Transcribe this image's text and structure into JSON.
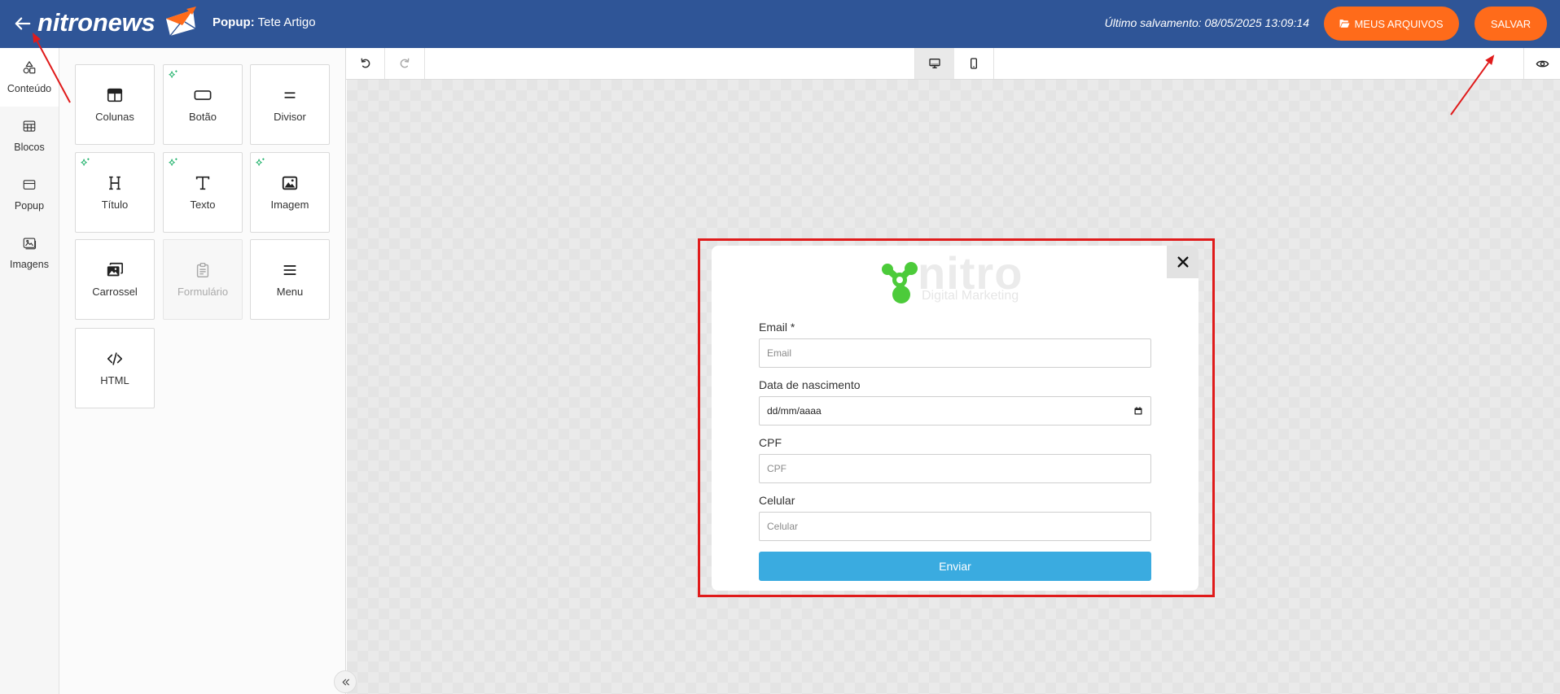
{
  "colors": {
    "header_bar": "#2f5597",
    "accent_orange": "#ff6b1a",
    "submit_button": "#3aabe0",
    "ai_sparkle": "#2bb673",
    "logo_green": "#4ccb3a",
    "annotation_red": "#e01b1b"
  },
  "header": {
    "brand": "nitronews",
    "brand_icon": "envelope-logo-icon",
    "back_icon": "arrow-left-icon",
    "title_prefix": "Popup:",
    "title": "Tete Artigo",
    "last_saved": "Último salvamento: 08/05/2025 13:09:14",
    "my_files": {
      "label": "MEUS ARQUIVOS",
      "icon": "folder-open-icon"
    },
    "save": {
      "label": "SALVAR"
    }
  },
  "sidebar": {
    "items": [
      {
        "label": "Conteúdo",
        "icon": "shapes-icon",
        "active": true
      },
      {
        "label": "Blocos",
        "icon": "blocks-grid-icon",
        "active": false
      },
      {
        "label": "Popup",
        "icon": "popup-window-icon",
        "active": false
      },
      {
        "label": "Imagens",
        "icon": "images-icon",
        "active": false
      }
    ]
  },
  "content_panel": {
    "blocks": [
      {
        "label": "Colunas",
        "icon": "columns-icon",
        "ai": false,
        "disabled": false
      },
      {
        "label": "Botão",
        "icon": "button-icon",
        "ai": true,
        "disabled": false
      },
      {
        "label": "Divisor",
        "icon": "divider-icon",
        "ai": false,
        "disabled": false
      },
      {
        "label": "Título",
        "icon": "heading-icon",
        "ai": true,
        "disabled": false
      },
      {
        "label": "Texto",
        "icon": "text-icon",
        "ai": true,
        "disabled": false
      },
      {
        "label": "Imagem",
        "icon": "image-icon",
        "ai": true,
        "disabled": false
      },
      {
        "label": "Carrossel",
        "icon": "carousel-icon",
        "ai": false,
        "disabled": false
      },
      {
        "label": "Formulário",
        "icon": "form-clipboard-icon",
        "ai": false,
        "disabled": true
      },
      {
        "label": "Menu",
        "icon": "menu-icon",
        "ai": false,
        "disabled": false
      },
      {
        "label": "HTML",
        "icon": "code-icon",
        "ai": false,
        "disabled": false
      }
    ],
    "collapse_icon": "double-chevron-left-icon"
  },
  "toolbar": {
    "undo_icon": "undo-icon",
    "redo_icon": "redo-icon",
    "views": [
      {
        "icon": "desktop-icon",
        "active": true
      },
      {
        "icon": "mobile-icon",
        "active": false
      }
    ],
    "preview_icon": "eye-icon"
  },
  "popup": {
    "close_icon": "close-icon",
    "logo": {
      "icon": "nitro-molecule-logo-icon",
      "name": "nitro",
      "tagline": "Digital Marketing"
    },
    "form": {
      "fields": [
        {
          "label": "Email *",
          "placeholder": "Email"
        },
        {
          "label": "Data de nascimento",
          "value": "dd/mm/aaaa",
          "icon": "calendar-icon"
        },
        {
          "label": "CPF",
          "placeholder": "CPF"
        },
        {
          "label": "Celular",
          "placeholder": "Celular"
        }
      ],
      "submit_label": "Enviar"
    }
  }
}
